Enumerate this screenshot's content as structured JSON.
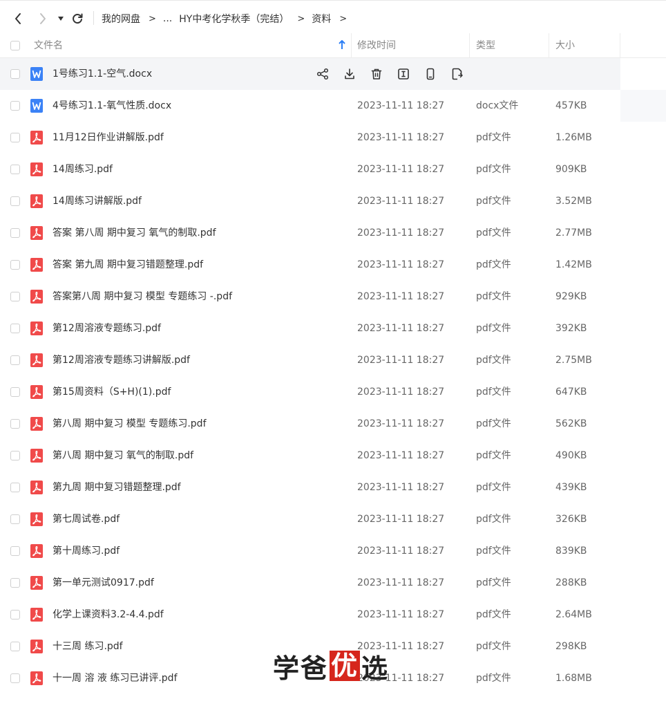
{
  "breadcrumb": {
    "items": [
      "我的网盘",
      "...",
      "HY中考化学秋季（完结）",
      "资料"
    ],
    "separator": ">"
  },
  "header": {
    "name": "文件名",
    "modified": "修改时间",
    "type": "类型",
    "size": "大小"
  },
  "files": [
    {
      "name": "1号练习1.1-空气.docx",
      "date": "",
      "type": "",
      "size": "",
      "kind": "word",
      "hover": true
    },
    {
      "name": "4号练习1.1-氧气性质.docx",
      "date": "2023-11-11 18:27",
      "type": "docx文件",
      "size": "457KB",
      "kind": "word",
      "hover": false
    },
    {
      "name": "11月12日作业讲解版.pdf",
      "date": "2023-11-11 18:27",
      "type": "pdf文件",
      "size": "1.26MB",
      "kind": "pdf",
      "hover": false
    },
    {
      "name": "14周练习.pdf",
      "date": "2023-11-11 18:27",
      "type": "pdf文件",
      "size": "909KB",
      "kind": "pdf",
      "hover": false
    },
    {
      "name": "14周练习讲解版.pdf",
      "date": "2023-11-11 18:27",
      "type": "pdf文件",
      "size": "3.52MB",
      "kind": "pdf",
      "hover": false
    },
    {
      "name": "答案 第八周 期中复习 氧气的制取.pdf",
      "date": "2023-11-11 18:27",
      "type": "pdf文件",
      "size": "2.77MB",
      "kind": "pdf",
      "hover": false
    },
    {
      "name": "答案 第九周 期中复习错题整理.pdf",
      "date": "2023-11-11 18:27",
      "type": "pdf文件",
      "size": "1.42MB",
      "kind": "pdf",
      "hover": false
    },
    {
      "name": "答案第八周 期中复习 模型 专题练习 -.pdf",
      "date": "2023-11-11 18:27",
      "type": "pdf文件",
      "size": "929KB",
      "kind": "pdf",
      "hover": false
    },
    {
      "name": "第12周溶液专题练习.pdf",
      "date": "2023-11-11 18:27",
      "type": "pdf文件",
      "size": "392KB",
      "kind": "pdf",
      "hover": false
    },
    {
      "name": "第12周溶液专题练习讲解版.pdf",
      "date": "2023-11-11 18:27",
      "type": "pdf文件",
      "size": "2.75MB",
      "kind": "pdf",
      "hover": false
    },
    {
      "name": "第15周资料（S+H)(1).pdf",
      "date": "2023-11-11 18:27",
      "type": "pdf文件",
      "size": "647KB",
      "kind": "pdf",
      "hover": false
    },
    {
      "name": "第八周 期中复习 模型 专题练习.pdf",
      "date": "2023-11-11 18:27",
      "type": "pdf文件",
      "size": "562KB",
      "kind": "pdf",
      "hover": false
    },
    {
      "name": "第八周 期中复习 氧气的制取.pdf",
      "date": "2023-11-11 18:27",
      "type": "pdf文件",
      "size": "490KB",
      "kind": "pdf",
      "hover": false
    },
    {
      "name": "第九周 期中复习错题整理.pdf",
      "date": "2023-11-11 18:27",
      "type": "pdf文件",
      "size": "439KB",
      "kind": "pdf",
      "hover": false
    },
    {
      "name": "第七周试卷.pdf",
      "date": "2023-11-11 18:27",
      "type": "pdf文件",
      "size": "326KB",
      "kind": "pdf",
      "hover": false
    },
    {
      "name": "第十周练习.pdf",
      "date": "2023-11-11 18:27",
      "type": "pdf文件",
      "size": "839KB",
      "kind": "pdf",
      "hover": false
    },
    {
      "name": "第一单元测试0917.pdf",
      "date": "2023-11-11 18:27",
      "type": "pdf文件",
      "size": "288KB",
      "kind": "pdf",
      "hover": false
    },
    {
      "name": "化学上课资料3.2-4.4.pdf",
      "date": "2023-11-11 18:27",
      "type": "pdf文件",
      "size": "2.64MB",
      "kind": "pdf",
      "hover": false
    },
    {
      "name": "十三周 练习.pdf",
      "date": "2023-11-11 18:27",
      "type": "pdf文件",
      "size": "298KB",
      "kind": "pdf",
      "hover": false
    },
    {
      "name": "十一周 溶 液 练习已讲评.pdf",
      "date": "2023-11-11 18:27",
      "type": "pdf文件",
      "size": "1.68MB",
      "kind": "pdf",
      "hover": false
    }
  ],
  "row_actions": [
    "share-icon",
    "download-icon",
    "delete-icon",
    "rename-icon",
    "phone-icon",
    "copy-icon"
  ],
  "watermark": {
    "part1": "学爸",
    "part2": "优",
    "part3": "选"
  },
  "colors": {
    "accent": "#2b7ef5",
    "word": "#3b82f6",
    "pdf": "#f04a4a",
    "hover_row": "#f4f5f7"
  }
}
